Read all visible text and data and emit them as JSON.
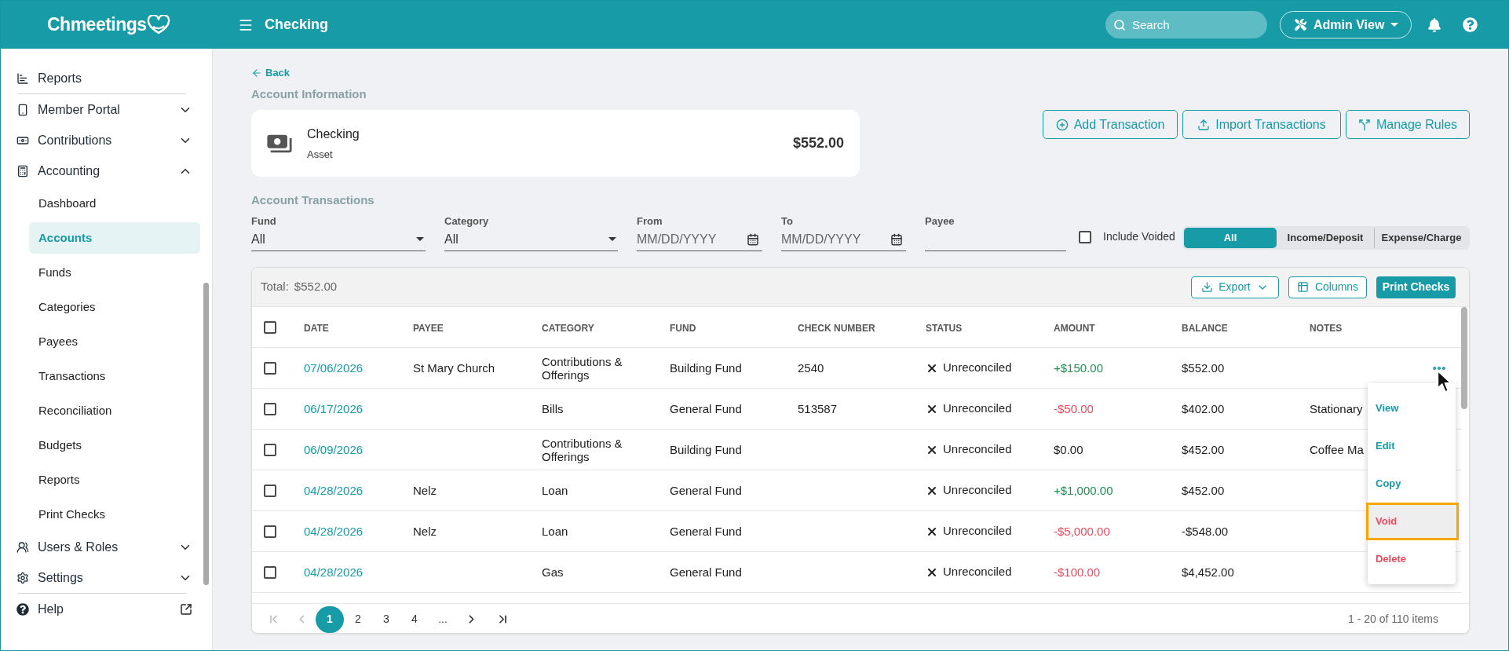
{
  "header": {
    "logo": "Chmeetings",
    "title": "Checking",
    "search": {
      "placeholder": "Search"
    },
    "view_button": "Admin View"
  },
  "sidebar": {
    "sections": [
      {
        "items": [
          {
            "label": "Reports",
            "kind": "link"
          }
        ]
      },
      {
        "items": [
          {
            "label": "Member Portal",
            "kind": "group",
            "expanded": false
          },
          {
            "label": "Contributions",
            "kind": "group",
            "expanded": false
          },
          {
            "label": "Accounting",
            "kind": "group",
            "expanded": true,
            "children": [
              {
                "label": "Dashboard",
                "selected": false
              },
              {
                "label": "Accounts",
                "selected": true
              },
              {
                "label": "Funds",
                "selected": false
              },
              {
                "label": "Categories",
                "selected": false
              },
              {
                "label": "Payees",
                "selected": false
              },
              {
                "label": "Transactions",
                "selected": false
              },
              {
                "label": "Reconciliation",
                "selected": false
              },
              {
                "label": "Budgets",
                "selected": false
              },
              {
                "label": "Reports",
                "selected": false
              },
              {
                "label": "Print Checks",
                "selected": false
              }
            ]
          },
          {
            "label": "Users & Roles",
            "kind": "group",
            "expanded": false
          },
          {
            "label": "Settings",
            "kind": "group",
            "expanded": false
          }
        ]
      },
      {
        "items": [
          {
            "label": "Help",
            "kind": "external"
          }
        ]
      }
    ]
  },
  "back": "Back",
  "account_info": {
    "title": "Account Information",
    "name": "Checking",
    "type": "Asset",
    "balance": "$552.00"
  },
  "actions": [
    "Add Transaction",
    "Import Transactions",
    "Manage Rules"
  ],
  "transactions": {
    "title": "Account Transactions",
    "filters": [
      {
        "kind": "select",
        "label": "Fund",
        "value": "All"
      },
      {
        "kind": "select",
        "label": "Category",
        "value": "All"
      },
      {
        "kind": "date",
        "label": "From",
        "placeholder": "MM/DD/YYYY"
      },
      {
        "kind": "date",
        "label": "To",
        "placeholder": "MM/DD/YYYY"
      },
      {
        "kind": "text",
        "label": "Payee"
      }
    ],
    "include_voided": {
      "label": "Include Voided",
      "checked": false
    },
    "type_filter": [
      {
        "label": "All",
        "selected": true
      },
      {
        "label": "Income/Deposit",
        "selected": false
      },
      {
        "label": "Expense/Charge",
        "selected": false
      }
    ]
  },
  "table": {
    "total_label": "Total:",
    "total": "$552.00",
    "export": "Export",
    "columns_button": "Columns",
    "print": "Print Checks",
    "select_all": false,
    "columns": [
      "DATE",
      "PAYEE",
      "CATEGORY",
      "FUND",
      "CHECK NUMBER",
      "STATUS",
      "AMOUNT",
      "BALANCE",
      "NOTES"
    ],
    "rows": [
      {
        "checked": false,
        "date": "07/06/2026",
        "payee": "St Mary Church",
        "category": "Contributions & Offerings",
        "fund": "Building Fund",
        "check_number": "2540",
        "status": "Unreconciled",
        "reconciled": false,
        "amount": {
          "text": "+$150.00",
          "color": "#1f8f4f"
        },
        "balance": "$552.00",
        "menu_open": true
      },
      {
        "checked": false,
        "date": "06/17/2026",
        "category": "Bills",
        "fund": "General Fund",
        "check_number": "513587",
        "status": "Unreconciled",
        "reconciled": false,
        "amount": {
          "text": "-$50.00",
          "color": "#f0485c"
        },
        "balance": "$402.00",
        "notes": "Stationary",
        "menu_open": false
      },
      {
        "checked": false,
        "date": "06/09/2026",
        "category": "Contributions & Offerings",
        "fund": "Building Fund",
        "status": "Unreconciled",
        "reconciled": false,
        "amount": {
          "text": "$0.00",
          "color": "#212121"
        },
        "balance": "$452.00",
        "notes": "Coffee Ma",
        "menu_open": false
      },
      {
        "checked": false,
        "date": "04/28/2026",
        "payee": "Nelz",
        "category": "Loan",
        "fund": "General Fund",
        "status": "Unreconciled",
        "reconciled": false,
        "amount": {
          "text": "+$1,000.00",
          "color": "#1f8f4f"
        },
        "balance": "$452.00",
        "menu_open": false
      },
      {
        "checked": false,
        "date": "04/28/2026",
        "payee": "Nelz",
        "category": "Loan",
        "fund": "General Fund",
        "status": "Unreconciled",
        "reconciled": false,
        "amount": {
          "text": "-$5,000.00",
          "color": "#f0485c"
        },
        "balance": "-$548.00",
        "menu_open": false
      },
      {
        "checked": false,
        "date": "04/28/2026",
        "category": "Gas",
        "fund": "General Fund",
        "status": "Unreconciled",
        "reconciled": false,
        "amount": {
          "text": "-$100.00",
          "color": "#f0485c"
        },
        "balance": "$4,452.00",
        "menu_open": false
      }
    ],
    "row_menu": {
      "items": [
        {
          "label": "View",
          "kind": "default",
          "highlighted": false
        },
        {
          "label": "Edit",
          "kind": "default",
          "highlighted": false
        },
        {
          "label": "Copy",
          "kind": "default",
          "highlighted": false
        },
        {
          "label": "Void",
          "kind": "danger",
          "highlighted": true
        },
        {
          "label": "Delete",
          "kind": "danger",
          "highlighted": false
        }
      ]
    },
    "pagination": {
      "prev_disabled": true,
      "next_disabled": false,
      "pages": [
        {
          "label": "1",
          "selected": true
        },
        {
          "label": "2",
          "selected": false
        },
        {
          "label": "3",
          "selected": false
        },
        {
          "label": "4",
          "selected": false
        },
        {
          "label": "...",
          "selected": false
        }
      ],
      "summary": "1 - 20 of 110 items"
    }
  }
}
